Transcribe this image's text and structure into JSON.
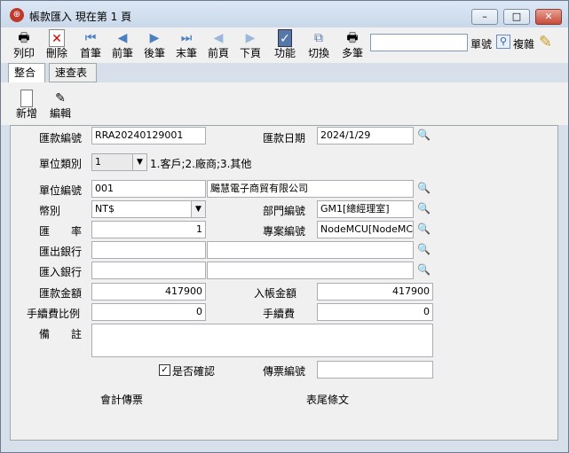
{
  "window": {
    "title": "帳款匯入  現在第 1 頁"
  },
  "toolbar": {
    "print": "列印",
    "delete": "刪除",
    "first": "首筆",
    "prev": "前筆",
    "next": "後筆",
    "last": "末筆",
    "prev_page": "前頁",
    "next_page": "下頁",
    "function": "功能",
    "switch": "切換",
    "multi": "多筆",
    "search_label": "單號",
    "copy": "複雜"
  },
  "tabs": {
    "integrate": "整合",
    "quick": "速查表"
  },
  "subbar": {
    "add": "新增",
    "edit": "編輯"
  },
  "form": {
    "remit_no_label": "匯款編號",
    "remit_no": "RRA20240129001",
    "remit_date_label": "匯款日期",
    "remit_date": "2024/1/29",
    "unit_type_label": "單位類別",
    "unit_type": "1",
    "unit_type_hint": "1.客戶;2.廠商;3.其他",
    "unit_no_label": "單位編號",
    "unit_no": "001",
    "unit_name": "颺慧電子商貿有限公司",
    "currency_label": "幣別",
    "currency": "NT$",
    "dept_label": "部門編號",
    "dept": "GM1[總經理室]",
    "rate_label": "匯　　率",
    "rate": "1",
    "project_label": "專案編號",
    "project": "NodeMCU[NodeMCU專",
    "out_bank_label": "匯出銀行",
    "out_bank": "",
    "out_bank_name": "",
    "in_bank_label": "匯入銀行",
    "in_bank": "",
    "in_bank_name": "",
    "remit_amount_label": "匯款金額",
    "remit_amount": "417900",
    "in_amount_label": "入帳金額",
    "in_amount": "417900",
    "fee_ratio_label": "手續費比例",
    "fee_ratio": "0",
    "fee_label": "手續費",
    "fee": "0",
    "note_label": "備　　註",
    "note": "",
    "confirmed_label": "是否確認",
    "voucher_no_label": "傳票編號",
    "voucher_no": "",
    "acct_voucher": "會計傳票",
    "footer_text": "表尾條文"
  }
}
